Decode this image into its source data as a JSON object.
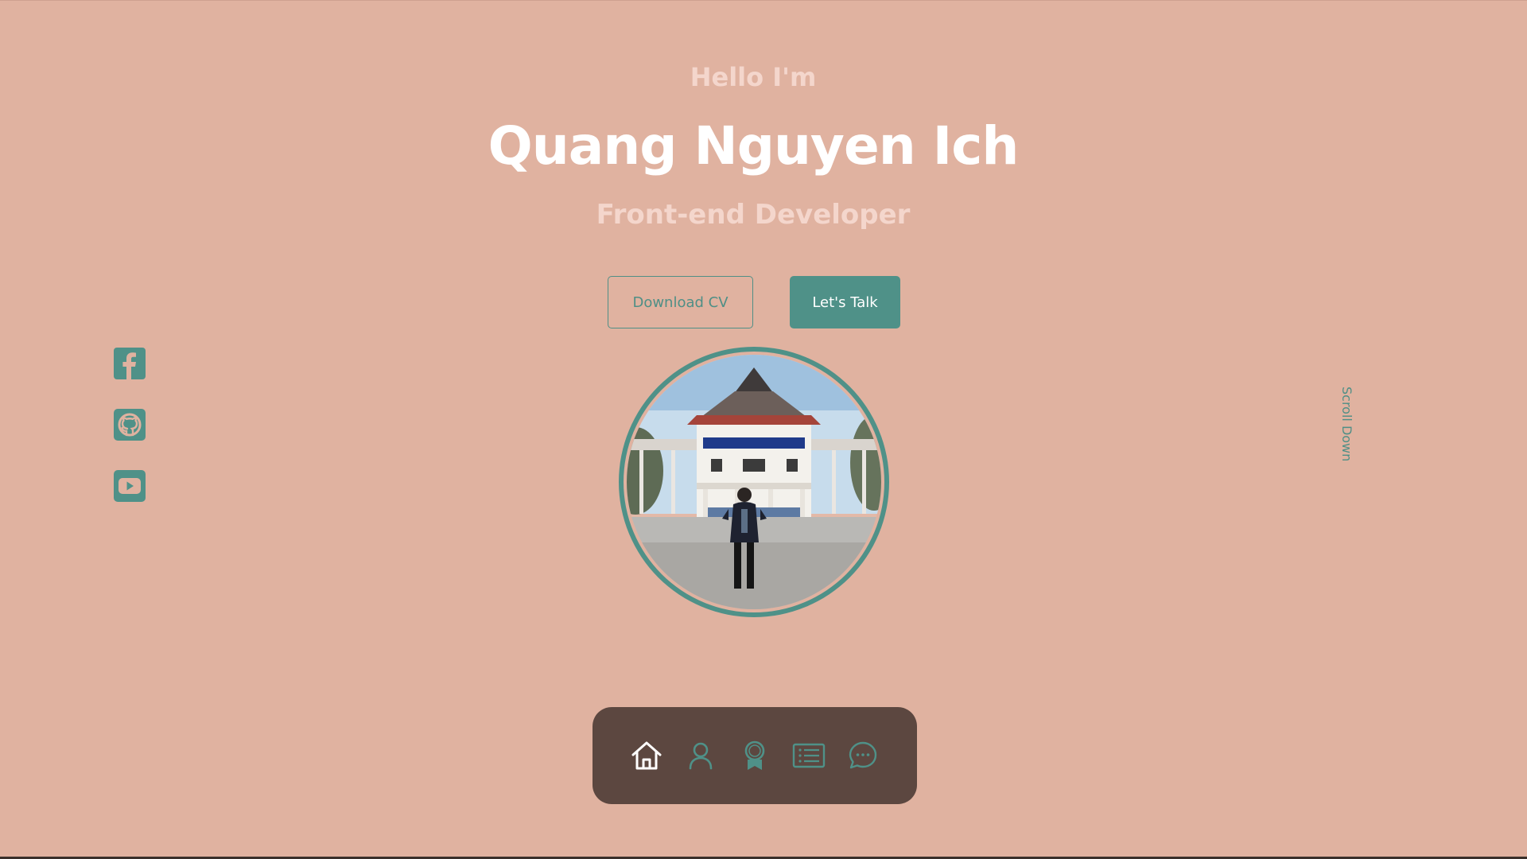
{
  "hero": {
    "greeting": "Hello I'm",
    "name": "Quang Nguyen Ich",
    "role": "Front-end Developer"
  },
  "buttons": {
    "download_cv": "Download CV",
    "lets_talk": "Let's Talk"
  },
  "socials": [
    {
      "icon": "facebook-icon"
    },
    {
      "icon": "github-icon"
    },
    {
      "icon": "youtube-icon"
    }
  ],
  "scroll": {
    "label": "Scroll Down"
  },
  "nav": {
    "items": [
      {
        "icon": "home-icon",
        "active": true
      },
      {
        "icon": "user-icon",
        "active": false
      },
      {
        "icon": "award-icon",
        "active": false
      },
      {
        "icon": "list-icon",
        "active": false
      },
      {
        "icon": "chat-icon",
        "active": false
      }
    ]
  },
  "colors": {
    "background": "#e0b2a0",
    "accent": "#4f9188",
    "navbar": "#5c4740",
    "text_light": "#f4d6cc"
  }
}
